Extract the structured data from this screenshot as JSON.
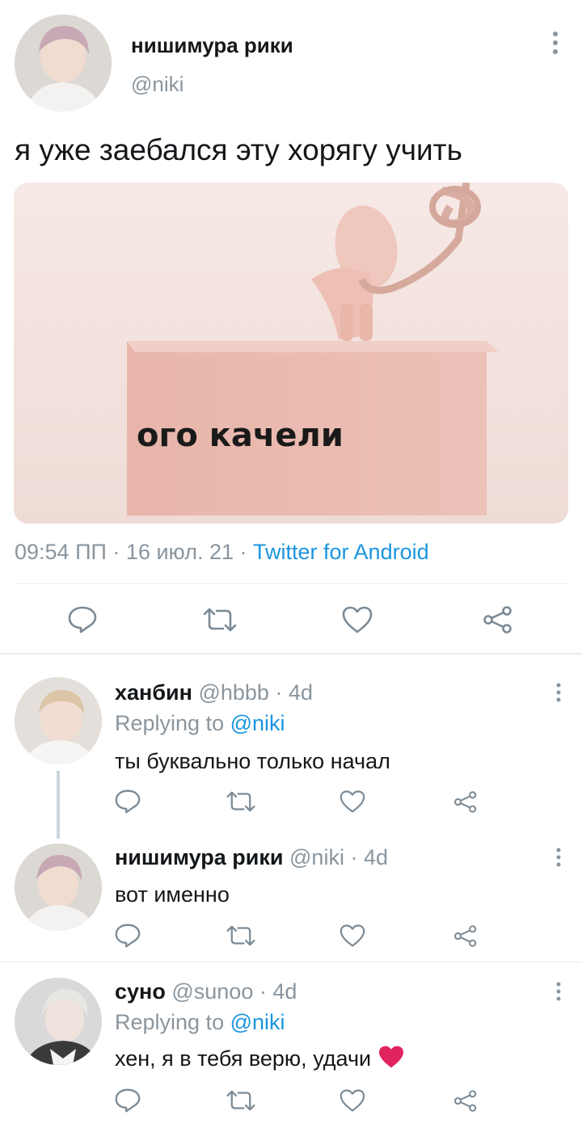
{
  "main_tweet": {
    "author_name": "нишимура рики",
    "author_handle": "@niki",
    "text": "я уже заебался эту хорягу учить",
    "image_caption": "ого качели",
    "time": "09:54 ПП",
    "date": "16 июл. 21",
    "sep": "·",
    "source": "Twitter for Android"
  },
  "replies": [
    {
      "name": "ханбин",
      "handle": "@hbbb",
      "age": "4d",
      "replying_label": "Replying to",
      "replying_to": "@niki",
      "text": "ты буквально только начал"
    },
    {
      "name": "нишимура рики",
      "handle": "@niki",
      "age": "4d",
      "text": "вот именно"
    },
    {
      "name": "суно",
      "handle": "@sunoo",
      "age": "4d",
      "replying_label": "Replying to",
      "replying_to": "@niki",
      "text": "хен, я в тебя верю, удачи",
      "emoji": "❤️"
    }
  ],
  "icons": [
    "more-vertical-icon",
    "reply-icon",
    "retweet-icon",
    "like-icon",
    "share-icon"
  ],
  "colors": {
    "link": "#1b95e0",
    "muted": "#8a959e",
    "text": "#14171a",
    "heart": "#e0245e"
  }
}
